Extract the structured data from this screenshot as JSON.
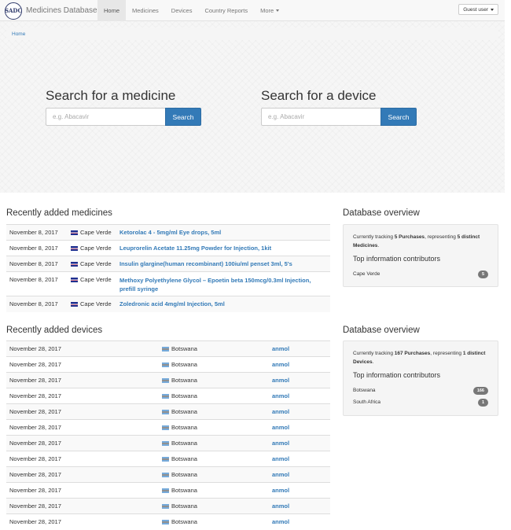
{
  "navbar": {
    "logo_text": "SADC",
    "brand": "Medicines Database",
    "items": [
      "Home",
      "Medicines",
      "Devices",
      "Country Reports",
      "More"
    ],
    "guest_label": "Guest user"
  },
  "breadcrumb": {
    "home": "Home"
  },
  "search": {
    "medicine": {
      "title": "Search for a medicine",
      "placeholder": "e.g. Abacavir",
      "button": "Search"
    },
    "device": {
      "title": "Search for a device",
      "placeholder": "e.g. Abacavir",
      "button": "Search"
    }
  },
  "recent_medicines": {
    "title": "Recently added medicines",
    "rows": [
      {
        "date": "November 8, 2017",
        "country": "Cape Verde",
        "name": "Ketorolac 4 - 5mg/ml Eye drops, 5ml"
      },
      {
        "date": "November 8, 2017",
        "country": "Cape Verde",
        "name": "Leuprorelin Acetate 11.25mg Powder for Injection, 1kit"
      },
      {
        "date": "November 8, 2017",
        "country": "Cape Verde",
        "name": "Insulin glargine(human recombinant) 100iu/ml penset 3ml, 5's"
      },
      {
        "date": "November 8, 2017",
        "country": "Cape Verde",
        "name": "Methoxy Polyethylene Glycol – Epoetin beta 150mcg/0.3ml Injection, prefill syringe"
      },
      {
        "date": "November 8, 2017",
        "country": "Cape Verde",
        "name": "Zoledronic acid 4mg/ml Injection, 5ml"
      }
    ]
  },
  "medicines_overview": {
    "title": "Database overview",
    "tracking_prefix": "Currently tracking ",
    "tracking_count": "5 Purchases",
    "tracking_mid": ", representing ",
    "tracking_distinct": "5 distinct Medicines",
    "tracking_suffix": ".",
    "contributors_title": "Top information contributors",
    "contributors": [
      {
        "name": "Cape Verde",
        "count": "5"
      }
    ]
  },
  "recent_devices": {
    "title": "Recently added devices",
    "rows": [
      {
        "date": "November 28, 2017",
        "country": "Botswana",
        "name": "anmol"
      },
      {
        "date": "November 28, 2017",
        "country": "Botswana",
        "name": "anmol"
      },
      {
        "date": "November 28, 2017",
        "country": "Botswana",
        "name": "anmol"
      },
      {
        "date": "November 28, 2017",
        "country": "Botswana",
        "name": "anmol"
      },
      {
        "date": "November 28, 2017",
        "country": "Botswana",
        "name": "anmol"
      },
      {
        "date": "November 28, 2017",
        "country": "Botswana",
        "name": "anmol"
      },
      {
        "date": "November 28, 2017",
        "country": "Botswana",
        "name": "anmol"
      },
      {
        "date": "November 28, 2017",
        "country": "Botswana",
        "name": "anmol"
      },
      {
        "date": "November 28, 2017",
        "country": "Botswana",
        "name": "anmol"
      },
      {
        "date": "November 28, 2017",
        "country": "Botswana",
        "name": "anmol"
      },
      {
        "date": "November 28, 2017",
        "country": "Botswana",
        "name": "anmol"
      },
      {
        "date": "November 28, 2017",
        "country": "Botswana",
        "name": "anmol"
      }
    ]
  },
  "devices_overview": {
    "title": "Database overview",
    "tracking_prefix": "Currently tracking ",
    "tracking_count": "167 Purchases",
    "tracking_mid": ", representing ",
    "tracking_distinct": "1 distinct Devices",
    "tracking_suffix": ".",
    "contributors_title": "Top information contributors",
    "contributors": [
      {
        "name": "Botswana",
        "count": "166"
      },
      {
        "name": "South Africa",
        "count": "1"
      }
    ]
  },
  "colors": {
    "link": "#337ab7",
    "button": "#337ab7",
    "badge": "#777777"
  }
}
